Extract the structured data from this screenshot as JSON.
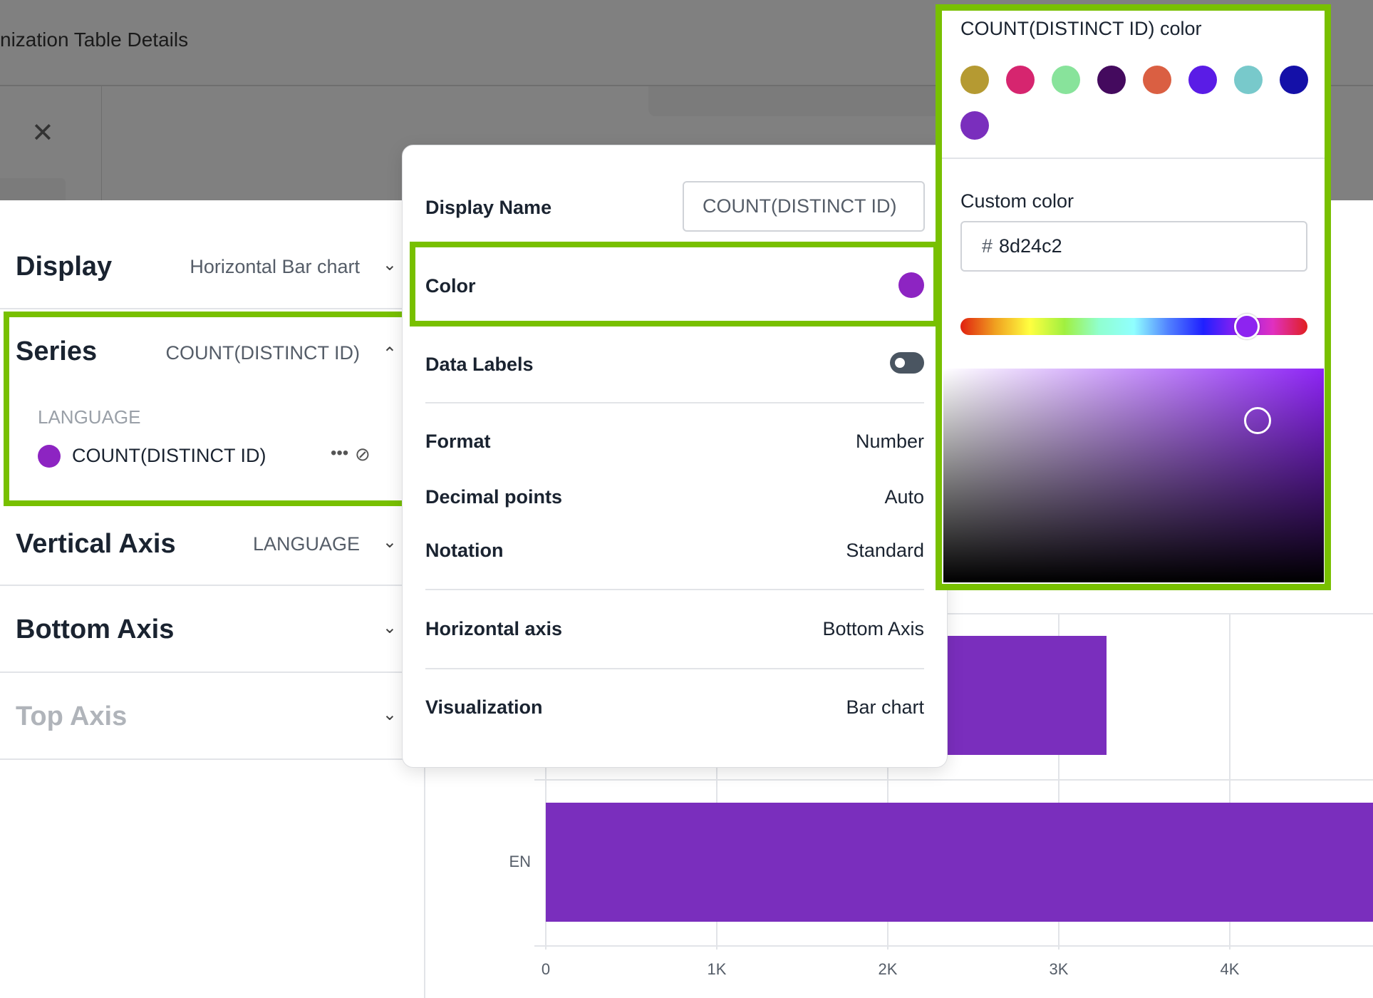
{
  "header": {
    "title": "nization Table Details",
    "close_icon": "close-icon"
  },
  "sidebar": {
    "display": {
      "label": "Display",
      "value": "Horizontal Bar chart"
    },
    "series": {
      "label": "Series",
      "value": "COUNT(DISTINCT ID)",
      "group_label": "LANGUAGE",
      "item": {
        "label": "COUNT(DISTINCT ID)",
        "color": "#8d24c2",
        "more_icon": "more-horizontal-icon",
        "visibility_icon": "eye-off-icon"
      }
    },
    "vertical_axis": {
      "label": "Vertical Axis",
      "value": "LANGUAGE"
    },
    "bottom_axis": {
      "label": "Bottom Axis"
    },
    "top_axis": {
      "label": "Top Axis"
    }
  },
  "series_settings": {
    "display_name_label": "Display Name",
    "display_name_value": "COUNT(DISTINCT ID)",
    "color_label": "Color",
    "color": "#8d24c2",
    "data_labels_label": "Data Labels",
    "data_labels_enabled": false,
    "format_label": "Format",
    "format_value": "Number",
    "decimal_label": "Decimal points",
    "decimal_value": "Auto",
    "notation_label": "Notation",
    "notation_value": "Standard",
    "haxis_label": "Horizontal axis",
    "haxis_value": "Bottom Axis",
    "viz_label": "Visualization",
    "viz_value": "Bar chart"
  },
  "color_picker": {
    "title": "COUNT(DISTINCT ID) color",
    "swatches": [
      "#b59a32",
      "#d6256f",
      "#88e39b",
      "#440a5e",
      "#da5f42",
      "#5a1ce6",
      "#78c9cb",
      "#1410a8",
      "#7a2ebd"
    ],
    "custom_label": "Custom color",
    "hash": "#",
    "hex_value": "8d24c2"
  },
  "chart_data": {
    "type": "bar",
    "orientation": "horizontal",
    "categories": [
      "",
      "EN"
    ],
    "values": [
      3280,
      5200
    ],
    "x_ticks": [
      "0",
      "1K",
      "2K",
      "3K",
      "4K"
    ],
    "xlim": [
      0,
      4800
    ],
    "bar_color": "#7a2ebd",
    "grid": true
  }
}
